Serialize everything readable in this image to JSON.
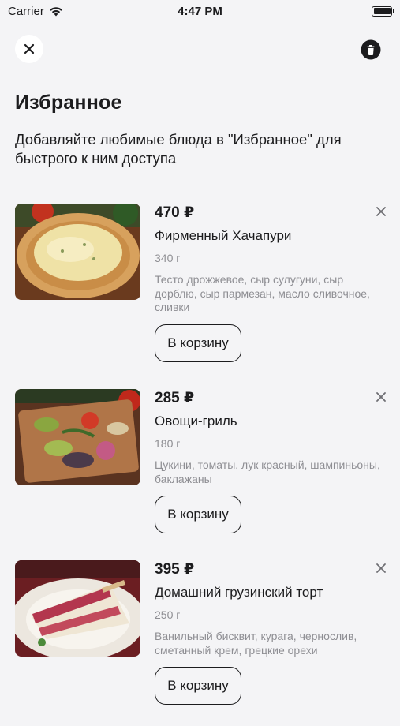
{
  "status_bar": {
    "carrier": "Carrier",
    "time": "4:47 PM"
  },
  "header": {
    "close_icon": "close-icon",
    "trash_icon": "trash-icon",
    "title": "Избранное",
    "subtitle": "Добавляйте любимые блюда в \"Избранное\" для быстрого к ним доступа"
  },
  "items": [
    {
      "price": "470 ₽",
      "name": "Фирменный Хачапури",
      "weight": "340 г",
      "description": "Тесто дрожжевое, сыр сулугуни, сыр дорблю, сыр пармезан, масло сливочное, сливки",
      "button": "В корзину"
    },
    {
      "price": "285 ₽",
      "name": "Овощи-гриль",
      "weight": "180 г",
      "description": "Цукини, томаты, лук красный, шампиньоны, баклажаны",
      "button": "В корзину"
    },
    {
      "price": "395 ₽",
      "name": "Домашний грузинский торт",
      "weight": "250 г",
      "description": "Ванильный бисквит, курага, чернослив, сметанный крем, грецкие орехи",
      "button": "В корзину"
    }
  ],
  "colors": {
    "background": "#f4f4f6",
    "text": "#1c1c1e",
    "muted": "#8e8e93"
  }
}
